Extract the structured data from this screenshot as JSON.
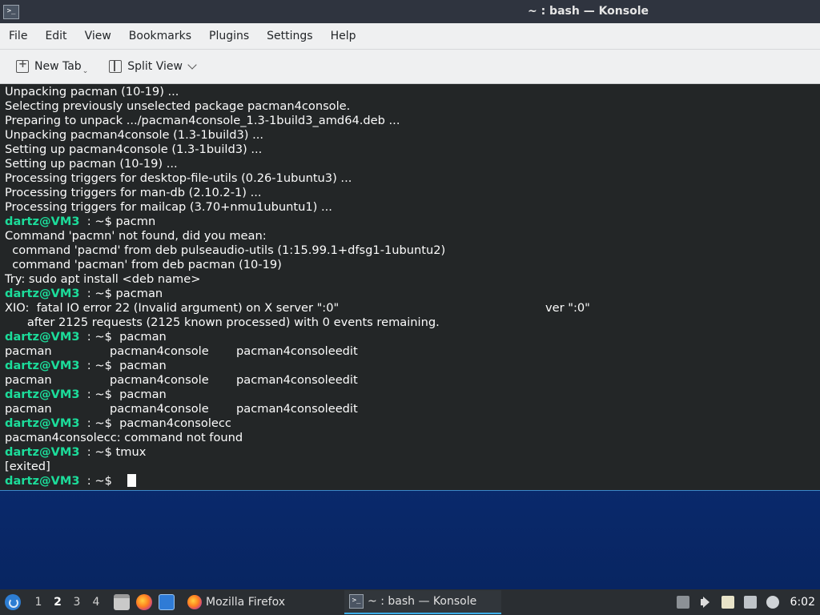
{
  "window": {
    "title": "~ : bash — Konsole",
    "app_icon_glyph": ">_"
  },
  "menubar": {
    "items": [
      "File",
      "Edit",
      "View",
      "Bookmarks",
      "Plugins",
      "Settings",
      "Help"
    ]
  },
  "toolbar": {
    "new_tab_label": "New Tab",
    "split_view_label": "Split View"
  },
  "terminal": {
    "cursor_glyph": " ",
    "lines": [
      {
        "text": "Unpacking pacman (10-19) ..."
      },
      {
        "text": "Selecting previously unselected package pacman4console."
      },
      {
        "text": "Preparing to unpack .../pacman4console_1.3-1build3_amd64.deb ..."
      },
      {
        "text": "Unpacking pacman4console (1.3-1build3) ..."
      },
      {
        "text": "Setting up pacman4console (1.3-1build3) ..."
      },
      {
        "text": "Setting up pacman (10-19) ..."
      },
      {
        "text": "Processing triggers for desktop-file-utils (0.26-1ubuntu3) ..."
      },
      {
        "text": "Processing triggers for man-db (2.10.2-1) ..."
      },
      {
        "text": "Processing triggers for mailcap (3.70+nmu1ubuntu1) ..."
      },
      {
        "user": "dartz@VM3",
        "prompt": "  : ~$ ",
        "cmd": "pacmn"
      },
      {
        "text": "Command 'pacmn' not found, did you mean:"
      },
      {
        "text": "  command 'pacmd' from deb pulseaudio-utils (1:15.99.1+dfsg1-1ubuntu2)"
      },
      {
        "text": "  command 'pacman' from deb pacman (10-19)"
      },
      {
        "text": "Try: sudo apt install <deb name>"
      },
      {
        "user": "dartz@VM3",
        "prompt": "  : ~$ ",
        "cmd": "pacman"
      },
      {
        "text": "XIO:  fatal IO error 22 (Invalid argument) on X server \":0\"",
        "right": "ver \":0\""
      },
      {
        "text": "      after 2125 requests (2125 known processed) with 0 events remaining."
      },
      {
        "user": "dartz@VM3",
        "prompt": "  : ~$  ",
        "cmd": "pacman"
      },
      {
        "cols": [
          "pacman",
          "pacman4console",
          "pacman4consoleedit"
        ]
      },
      {
        "user": "dartz@VM3",
        "prompt": "  : ~$  ",
        "cmd": "pacman"
      },
      {
        "cols": [
          "pacman",
          "pacman4console",
          "pacman4consoleedit"
        ]
      },
      {
        "user": "dartz@VM3",
        "prompt": "  : ~$  ",
        "cmd": "pacman"
      },
      {
        "cols": [
          "pacman",
          "pacman4console",
          "pacman4consoleedit"
        ]
      },
      {
        "user": "dartz@VM3",
        "prompt": "  : ~$  ",
        "cmd": "pacman4consolecc"
      },
      {
        "text": "pacman4consolecc: command not found"
      },
      {
        "user": "dartz@VM3",
        "prompt": "  : ~$ ",
        "cmd": "tmux"
      },
      {
        "text": "[exited]"
      },
      {
        "user": "dartz@VM3",
        "prompt": "  : ~$ ",
        "cmd": "",
        "cursor": true
      }
    ]
  },
  "taskbar": {
    "workspaces": [
      "1",
      "2",
      "3",
      "4"
    ],
    "active_workspace": "2",
    "tasks": [
      {
        "label": "Mozilla Firefox",
        "icon": "firefox-icon",
        "active": false
      },
      {
        "label": "~ : bash — Konsole",
        "icon": "konsole-icon",
        "active": true
      }
    ],
    "clock": "6:02",
    "colors": {
      "accent": "#3daee9",
      "prompt_user": "#1cdc9a"
    }
  }
}
